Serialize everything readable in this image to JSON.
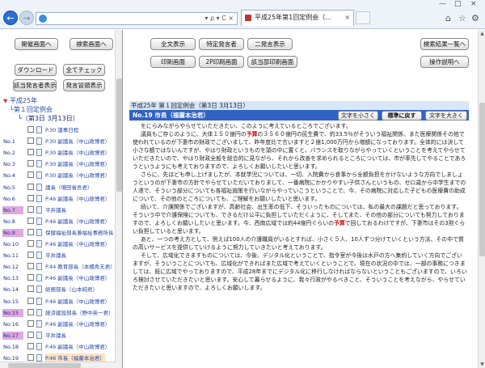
{
  "browser": {
    "address": "",
    "address_tools": "▾ ρ ▾ C ×",
    "tab_title": "平成25年第1回定例会（...",
    "tab_close": "×",
    "window_controls": {
      "minimize": "—",
      "maximize": "□",
      "close": "×"
    },
    "right_tools": {
      "home": "⌂",
      "favorites": "☆",
      "settings": "⚙"
    }
  },
  "left": {
    "buttons": {
      "kaigi_gamen": "開催画面へ",
      "kensaku_gamen": "検索画面へ",
      "download": "ダウンロード",
      "all_check": "全てチェック",
      "select_speaker": "該当発言者表示",
      "speaker_list": "発言冒頭表示"
    },
    "tree": {
      "year": "平成25年",
      "session": "第１回定例会",
      "date": "（第3日  3月13日）"
    },
    "rows": [
      {
        "no": "",
        "label": "P.30  議事日程",
        "hl": false,
        "sel": false
      },
      {
        "no": "No.1",
        "label": "P.30  副議長（中山政博君）",
        "hl": false,
        "sel": false
      },
      {
        "no": "No.2",
        "label": "P.30  副議長（中山政博君）",
        "hl": false,
        "sel": false
      },
      {
        "no": "No.3",
        "label": "P.30  副議長（中山政博君）",
        "hl": false,
        "sel": false
      },
      {
        "no": "No.4",
        "label": "P.30  副議長（中山政博君）",
        "hl": false,
        "sel": false
      },
      {
        "no": "No.5",
        "label": "議長（増田省吾君）",
        "hl": false,
        "sel": false
      },
      {
        "no": "No.6",
        "label": "P.46  副議長（中山政博君）",
        "hl": false,
        "sel": false
      },
      {
        "no": "No.7",
        "label": "平井議長",
        "hl": true,
        "sel": false
      },
      {
        "no": "No.8",
        "label": "P.46  副議長（中山政博君）",
        "hl": false,
        "sel": false
      },
      {
        "no": "No.9",
        "label": "保健福祉部長兼福祉事務所長",
        "hl": true,
        "sel": false
      },
      {
        "no": "No.10",
        "label": "P.46  副議長（中山政博君）",
        "hl": false,
        "sel": false
      },
      {
        "no": "No.11",
        "label": "平井議長",
        "hl": false,
        "sel": false
      },
      {
        "no": "No.12",
        "label": "P.44  教育部長（本橋秀夫君）",
        "hl": false,
        "sel": false
      },
      {
        "no": "No.13",
        "label": "P.46  副議長（中山政博君）",
        "hl": false,
        "sel": false
      },
      {
        "no": "No.14",
        "label": "総務部長（山本純君）",
        "hl": false,
        "sel": false
      },
      {
        "no": "No.15",
        "label": "P.46  副議長（中山政博君）",
        "hl": false,
        "sel": false
      },
      {
        "no": "No.15",
        "label": "経済建設部長（野中英一君）",
        "hl": true,
        "sel": false
      },
      {
        "no": "No.16",
        "label": "P.46  副議長（中山政博君）",
        "hl": false,
        "sel": false
      },
      {
        "no": "No.17",
        "label": "平井議長",
        "hl": true,
        "sel": false
      },
      {
        "no": "No.18",
        "label": "P.46  副議長（中山政博君）",
        "hl": false,
        "sel": false
      },
      {
        "no": "No.19",
        "label": "P.46  市長（福薗本治君）",
        "hl": false,
        "sel": true
      }
    ]
  },
  "right": {
    "buttons": {
      "all_display": "全文表示",
      "specific_speaker": "特定発言者",
      "two_screen": "二発言表示",
      "search_results": "検索結果一覧へ",
      "print_screen": "印刷画面",
      "page_print": "2P印刷画面",
      "selected_print": "該当部印刷画面",
      "help": "操作説明へ"
    },
    "header1": "平成25年 第１回定例会（第3日 3月13日）",
    "header2": "No.19  市長（福薗本治君）",
    "text_small": "文字を小さく",
    "text_reset": "標準に戻す",
    "text_large": "文字を大きく",
    "paragraphs": [
      "をにらみながらやらせていただきたい、このように考えているところでございます。",
      "議員もご存じのように、大体１５０億円の予算の３５６０億円の民生費で、約33.5％がそういう福祉関係、また医療関係その他で使われているのが下妻市の財政でございまして、昨年度比で言いますと２億1,000万円から増額になっております。全体的には決して小さな額ではないんですが、やはり財政というものを頭の中に置くと、バランスを取りながらやっていくということを考えてやらせていただきたいので、やはり財政全般を総合的に見ながら、それから改善を求められるところについては、市が率先してやることであろうというようにも考えておりますので、よろしくお願いしたいと思います。",
      "さらに、先ほども申し上げましたが、本就学児については、一切、入院費から食事から全額負担をかけないような方向でしましょうというのが下妻市の方針でやらせていただいておりまして、一番病院にかかりやすい子供さんというもの、ゼロ歳から中学生までの人達で、そういう部分についても各福祉施策を行いながらやっていこうということで、今、その病院に対応した子どもの医療費の助成について、その他のところについても、ご理解をお願いしたいと思います。",
      "続いて、介護関係でございますが、高齢社会、出生率の低下、そういったものについては、私の最大の課題だと思っております。そういう中で介護保険についても、できるだけ公平に負担していただくように、そしてまた、その他の部分についても努力しておりますので、よろしくお願いしたいと思います。今、西南広域では約44億円ぐらいの予算で回しておるわけですが、下妻市はその3割ぐらい負担していると思います。",
      "あと、一つの考え方として、例えば100人の介護職員がいるとすれば、小さく５人、10人ずつ分けていくという方法、その中で質の高いサービスを提供していけるように努力していきたいと考えております。",
      "そして、広域化できますものについては、今後、デジタル化ということで、指令室が今後は水戸の方へ集約していく方向でございますが、そういうことについても、広域化ができればまた広域で考えていくということで、現在の状況の中では、一部の事務につきましては、既に広域でやっておりますので、平成28年までにデジタル化に移行しなければならないということもございますので、いろいろ検討させていただきたいと思います。安心して暮らせるように、我々行政がやるべきこと、そういうことを考えながら、やらせていただきたいと思いますので、よろしくお願いします。"
    ]
  }
}
